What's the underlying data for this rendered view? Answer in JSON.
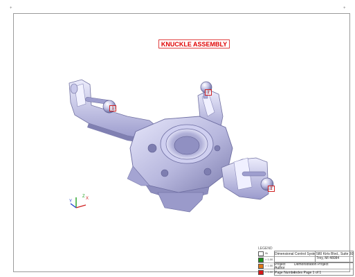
{
  "sheet": {
    "title": "KNUCKLE ASSEMBLY",
    "corner_marker": "+"
  },
  "markers": [
    {
      "label": "1"
    },
    {
      "label": "1"
    },
    {
      "label": "1"
    }
  ],
  "axes": {
    "x": "X",
    "y": "Y",
    "z": "Z"
  },
  "legend": {
    "label": "LEGEND",
    "rows": [
      {
        "value": "0k",
        "color": "#ffffff"
      },
      {
        "value": "> 1.00",
        "color": "#1a8f1a"
      },
      {
        "value": "> 1.00",
        "color": "#e07818"
      },
      {
        "value": "> 1.00",
        "color": "#d81818"
      }
    ],
    "company": "Dimensional Control Systems",
    "address_line1": "580 Kirts Blvd., Suite 309",
    "address_line2": "Troy, MI 48084",
    "project_label": "Project",
    "project_value": "Demonstration Project",
    "author_label": "Author",
    "page_label": "Page Number",
    "page_value": "Index Page 1 of 1"
  },
  "colors": {
    "part_light": "#dcdcf4",
    "part_mid": "#b4b4dc",
    "part_dark": "#7878aa",
    "annotation_red": "#e00000"
  }
}
